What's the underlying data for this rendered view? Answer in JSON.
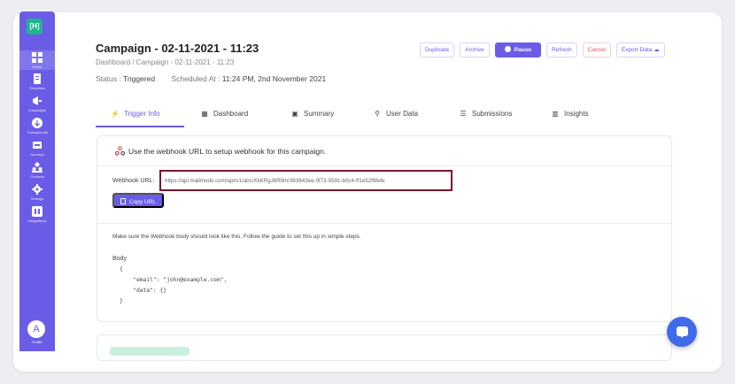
{
  "sidebar": {
    "logo": "[H]",
    "items": [
      {
        "label": "Home",
        "icon": "grid-icon"
      },
      {
        "label": "Templates",
        "icon": "document-icon"
      },
      {
        "label": "Campaigns",
        "icon": "megaphone-icon"
      },
      {
        "label": "Transactional",
        "icon": "transaction-icon"
      },
      {
        "label": "Journeys",
        "icon": "journey-icon"
      },
      {
        "label": "Contacts",
        "icon": "contacts-icon"
      },
      {
        "label": "Settings",
        "icon": "gear-icon"
      },
      {
        "label": "Integrations",
        "icon": "integrations-icon"
      }
    ],
    "avatar_initial": "A",
    "avatar_label": "Profile"
  },
  "header": {
    "title": "Campaign - 02-11-2021 - 11:23",
    "breadcrumb": "Dashboard / Campaign - 02-11-2021 - 11:23",
    "status_label": "Status :",
    "status_value": "Triggered",
    "scheduled_label": "Scheduled At :",
    "scheduled_value": "11:24 PM, 2nd November 2021"
  },
  "actions": {
    "duplicate": "Duplicate",
    "archive": "Archive",
    "pause": "Pause",
    "refresh": "Refresh",
    "cancel": "Cancel",
    "export": "Export Data"
  },
  "tabs": [
    {
      "label": "Trigger Info",
      "icon": "bolt-icon",
      "active": true
    },
    {
      "label": "Dashboard",
      "icon": "dashboard-icon"
    },
    {
      "label": "Summary",
      "icon": "summary-icon"
    },
    {
      "label": "User Data",
      "icon": "user-data-icon"
    },
    {
      "label": "Submissions",
      "icon": "submissions-icon"
    },
    {
      "label": "Insights",
      "icon": "insights-icon"
    }
  ],
  "trigger": {
    "title": "Use the webhook URL to setup webhook for this campaign.",
    "webhook_label": "Webhook URL:",
    "webhook_url": "https://api.mailmodo.com/api/v1/at/c/XkKRgJ6R9m/383643ee-0f73-5591-b0c4-ff1e52f9fefe",
    "copy_label": "Copy URL",
    "note": "Make sure the Webhook body should look like this. Follow the guide to set this up in simple steps.",
    "body_label": "Body",
    "body_code": "{\n    \"email\": \"john@example.com\",\n    \"data\": {}\n}"
  },
  "colors": {
    "accent": "#6b5ce7",
    "highlight_border": "#7a1530",
    "chat": "#3f6bea"
  }
}
